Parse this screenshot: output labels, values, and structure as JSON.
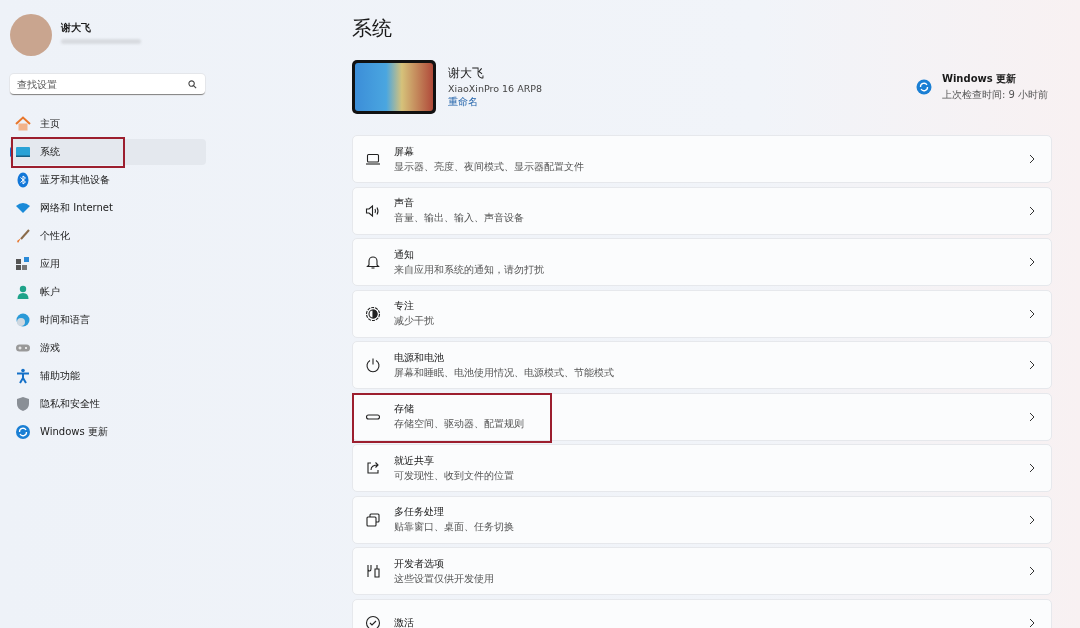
{
  "profile": {
    "name": "谢大飞"
  },
  "search": {
    "placeholder": "查找设置"
  },
  "sidebar": {
    "items": [
      {
        "label": "主页",
        "selected": false,
        "highlighted": false
      },
      {
        "label": "系统",
        "selected": true,
        "highlighted": true
      },
      {
        "label": "蓝牙和其他设备",
        "selected": false,
        "highlighted": false
      },
      {
        "label": "网络和 Internet",
        "selected": false,
        "highlighted": false
      },
      {
        "label": "个性化",
        "selected": false,
        "highlighted": false
      },
      {
        "label": "应用",
        "selected": false,
        "highlighted": false
      },
      {
        "label": "帐户",
        "selected": false,
        "highlighted": false
      },
      {
        "label": "时间和语言",
        "selected": false,
        "highlighted": false
      },
      {
        "label": "游戏",
        "selected": false,
        "highlighted": false
      },
      {
        "label": "辅助功能",
        "selected": false,
        "highlighted": false
      },
      {
        "label": "隐私和安全性",
        "selected": false,
        "highlighted": false
      },
      {
        "label": "Windows 更新",
        "selected": false,
        "highlighted": false
      }
    ]
  },
  "page": {
    "title": "系统"
  },
  "device": {
    "name": "谢大飞",
    "model": "XiaoXinPro 16 ARP8",
    "rename_link": "重命名"
  },
  "update": {
    "title": "Windows 更新",
    "subtitle": "上次检查时间: 9 小时前"
  },
  "settings": [
    {
      "title": "屏幕",
      "subtitle": "显示器、亮度、夜间模式、显示器配置文件",
      "highlighted": false
    },
    {
      "title": "声音",
      "subtitle": "音量、输出、输入、声音设备",
      "highlighted": false
    },
    {
      "title": "通知",
      "subtitle": "来自应用和系统的通知，请勿打扰",
      "highlighted": false
    },
    {
      "title": "专注",
      "subtitle": "减少干扰",
      "highlighted": false
    },
    {
      "title": "电源和电池",
      "subtitle": "屏幕和睡眠、电池使用情况、电源模式、节能模式",
      "highlighted": false
    },
    {
      "title": "存储",
      "subtitle": "存储空间、驱动器、配置规则",
      "highlighted": true
    },
    {
      "title": "就近共享",
      "subtitle": "可发现性、收到文件的位置",
      "highlighted": false
    },
    {
      "title": "多任务处理",
      "subtitle": "贴靠窗口、桌面、任务切换",
      "highlighted": false
    },
    {
      "title": "开发者选项",
      "subtitle": "这些设置仅供开发使用",
      "highlighted": false
    },
    {
      "title": "激活",
      "highlighted": false
    }
  ]
}
